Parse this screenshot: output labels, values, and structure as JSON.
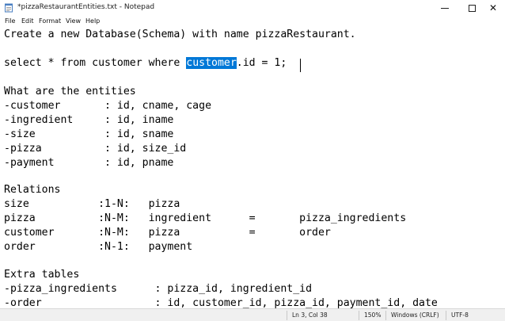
{
  "window": {
    "title": "*pizzaRestaurantEntities.txt - Notepad",
    "minimize_glyph": "—",
    "maximize_glyph": "☐",
    "close_glyph": "✕"
  },
  "menu": [
    "File",
    "Edit",
    "Format",
    "View",
    "Help"
  ],
  "editor": {
    "lines": [
      "Create a new Database(Schema) with name pizzaRestaurant.",
      "",
      "select * from customer where ",
      "",
      "What are the entities",
      "-customer       : id, cname, cage",
      "-ingredient     : id, iname",
      "-size           : id, sname",
      "-pizza          : id, size_id",
      "-payment        : id, pname",
      "",
      "Relations",
      "size           :1-N:   pizza",
      "pizza          :N-M:   ingredient      =       pizza_ingredients",
      "customer       :N-M:   pizza           =       order",
      "order          :N-1:   payment",
      "",
      "Extra tables",
      "-pizza_ingredients      : pizza_id, ingredient_id",
      "-order                  : id, customer_id, pizza_id, payment_id, date"
    ],
    "selected_word": "customer",
    "after_selection": ".id = 1;"
  },
  "status": {
    "position": "Ln 3, Col 38",
    "zoom": "150%",
    "line_ending": "Windows (CRLF)",
    "encoding": "UTF-8"
  }
}
